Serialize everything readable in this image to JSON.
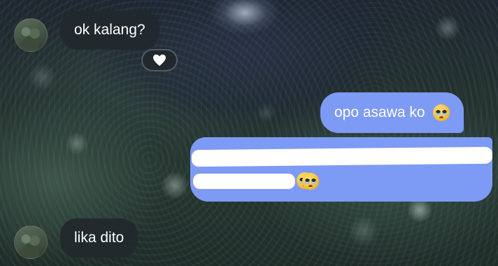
{
  "chat": {
    "messages": [
      {
        "from": "other",
        "text": "ok kalang?",
        "reaction": "heart"
      },
      {
        "from": "me",
        "text": "opo asawa ko",
        "emoji": "pleading-face"
      },
      {
        "from": "me",
        "text": "",
        "emoji_trailing": [
          "pleading-face",
          "pleading-face"
        ],
        "redacted": true
      },
      {
        "from": "other",
        "text": "lika dito"
      }
    ]
  },
  "colors": {
    "incoming_bubble": "#22282c",
    "outgoing_bubble": "#7d9bf4",
    "text": "#ffffff"
  }
}
